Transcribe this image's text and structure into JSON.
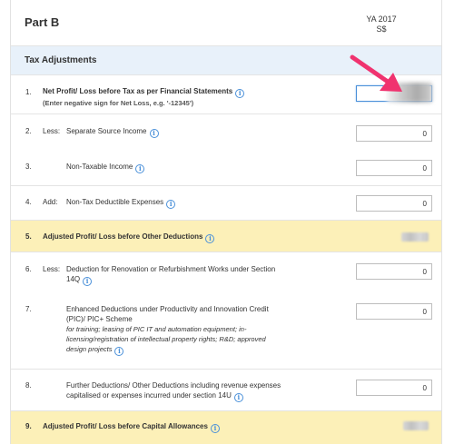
{
  "part_title": "Part B",
  "year_header": {
    "ya": "YA 2017",
    "currency": "S$"
  },
  "section_title": "Tax Adjustments",
  "rows": [
    {
      "num": "1.",
      "label": "Net Profit/ Loss before Tax as per Financial Statements",
      "sub": "(Enter negative sign for Net Loss, e.g. '-12345')",
      "value": ""
    },
    {
      "num": "2.",
      "prefix": "Less:",
      "label": "Separate Source Income",
      "value": "0"
    },
    {
      "num": "3.",
      "label": "Non-Taxable Income",
      "value": "0"
    },
    {
      "num": "4.",
      "prefix": "Add:",
      "label": "Non-Tax Deductible Expenses",
      "value": "0"
    },
    {
      "num": "5.",
      "label": "Adjusted Profit/ Loss before Other Deductions"
    },
    {
      "num": "6.",
      "prefix": "Less:",
      "label_l1": "Deduction for Renovation or Refurbishment Works under Section",
      "label_l2": "14Q",
      "value": "0"
    },
    {
      "num": "7.",
      "label_l1": "Enhanced Deductions under Productivity and Innovation Credit",
      "label_l2": "(PIC)/ PIC+ Scheme",
      "ital_l1": "for training; leasing of PIC IT and automation equipment; in-",
      "ital_l2": "licensing/registration of intellectual property rights; R&D; approved",
      "ital_l3": "design projects",
      "value": "0"
    },
    {
      "num": "8.",
      "label_l1": "Further Deductions/ Other Deductions including revenue expenses",
      "label_l2": "capitalised or expenses incurred under section 14U",
      "value": "0"
    },
    {
      "num": "9.",
      "label": "Adjusted Profit/ Loss before Capital Allowances"
    }
  ],
  "info_glyph": "i",
  "colors": {
    "section_bg": "#e8f1fa",
    "highlight_bg": "#fcf0b8",
    "info_blue": "#4a90d9",
    "arrow_pink": "#f0336f"
  }
}
